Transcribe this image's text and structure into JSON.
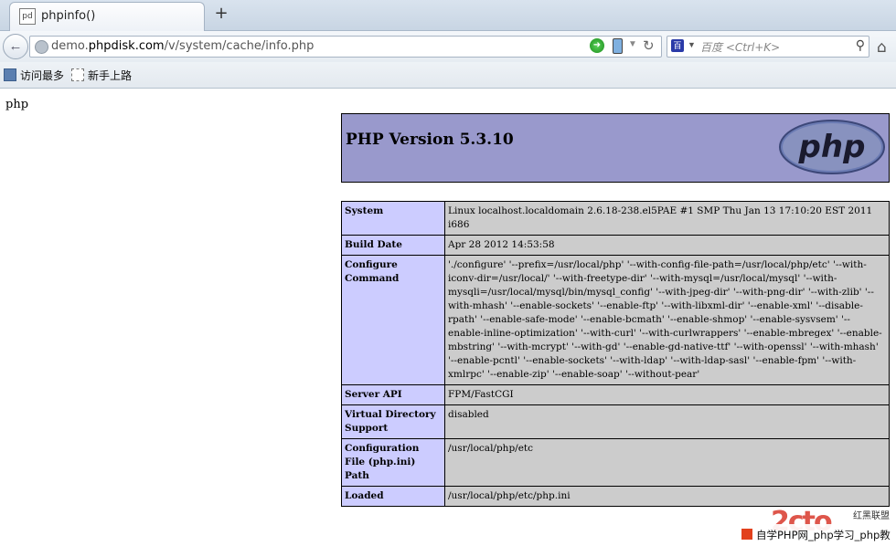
{
  "tab": {
    "favicon_text": "pd",
    "title": "phpinfo()",
    "new_tab": "+"
  },
  "nav": {
    "url_prefix": "demo.",
    "url_domain": "phpdisk.com",
    "url_path": "/v/system/cache/info.php",
    "search_engine": "百",
    "search_placeholder": "百度 <Ctrl+K>",
    "reload": "↻",
    "search_glyph": "⚲",
    "home_glyph": "⌂",
    "back_glyph": "←"
  },
  "bookmarks": [
    {
      "label": "访问最多"
    },
    {
      "label": "新手上路"
    }
  ],
  "page": {
    "prefix_text": "php",
    "php_version": "PHP Version 5.3.10",
    "logo_text": "php",
    "rows": [
      {
        "key": "System",
        "value": "Linux localhost.localdomain 2.6.18-238.el5PAE #1 SMP Thu Jan 13 17:10:20 EST 2011 i686"
      },
      {
        "key": "Build Date",
        "value": "Apr 28 2012 14:53:58"
      },
      {
        "key": "Configure Command",
        "value": "'./configure' '--prefix=/usr/local/php' '--with-config-file-path=/usr/local/php/etc' '--with-iconv-dir=/usr/local/' '--with-freetype-dir' '--with-mysql=/usr/local/mysql' '--with-mysqli=/usr/local/mysql/bin/mysql_config' '--with-jpeg-dir' '--with-png-dir' '--with-zlib' '--with-mhash' '--enable-sockets' '--enable-ftp' '--with-libxml-dir' '--enable-xml' '--disable-rpath' '--enable-safe-mode' '--enable-bcmath' '--enable-shmop' '--enable-sysvsem' '--enable-inline-optimization' '--with-curl' '--with-curlwrappers' '--enable-mbregex' '--enable-mbstring' '--with-mcrypt' '--with-gd' '--enable-gd-native-ttf' '--with-openssl' '--with-mhash' '--enable-pcntl' '--enable-sockets' '--with-ldap' '--with-ldap-sasl' '--enable-fpm' '--with-xmlrpc' '--enable-zip' '--enable-soap' '--without-pear'"
      },
      {
        "key": "Server API",
        "value": "FPM/FastCGI"
      },
      {
        "key": "Virtual Directory Support",
        "value": "disabled"
      },
      {
        "key": "Configuration File (php.ini) Path",
        "value": "/usr/local/php/etc"
      },
      {
        "key": "Loaded",
        "value": "/usr/local/php/etc/php.ini"
      }
    ]
  },
  "watermark": {
    "logo": "2cto",
    "sub": "红黑联盟",
    "bar_text": "自学PHP网_php学习_php教"
  },
  "colors": {
    "header_bg": "#9999cc",
    "key_bg": "#ccccff",
    "value_bg": "#cccccc"
  }
}
